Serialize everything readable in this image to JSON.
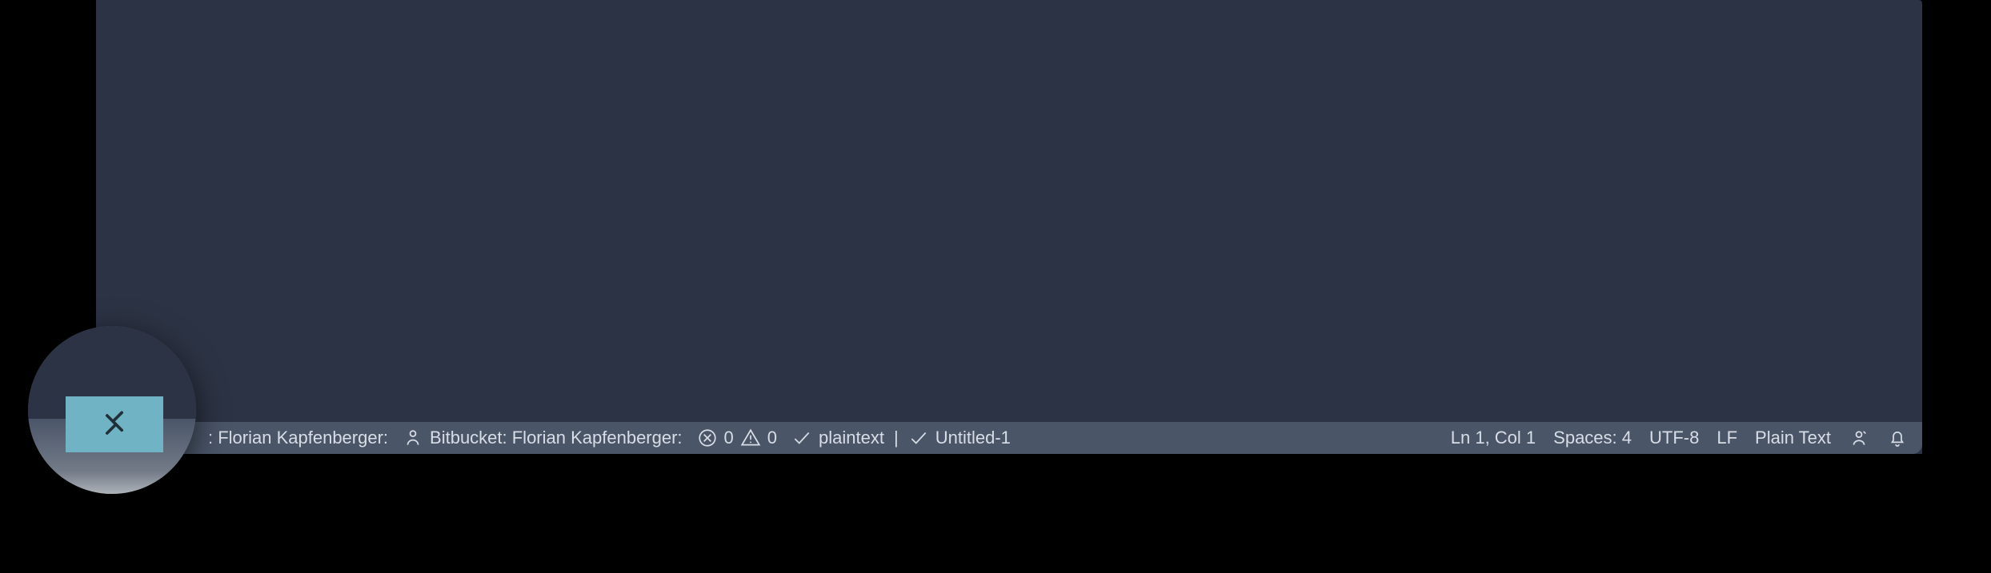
{
  "statusbar": {
    "left": {
      "user1_prefix": ": ",
      "user1_label": "Florian Kapfenberger:",
      "bitbucket_label": "Bitbucket: Florian Kapfenberger:",
      "errors": "0",
      "warnings": "0",
      "formatter_label": "plaintext",
      "pipe": "|",
      "format_doc_label": "Untitled-1"
    },
    "right": {
      "position_label": "Ln 1, Col 1",
      "indentation_label": "Spaces: 4",
      "encoding_label": "UTF-8",
      "eol_label": "LF",
      "language_label": "Plain Text"
    }
  }
}
